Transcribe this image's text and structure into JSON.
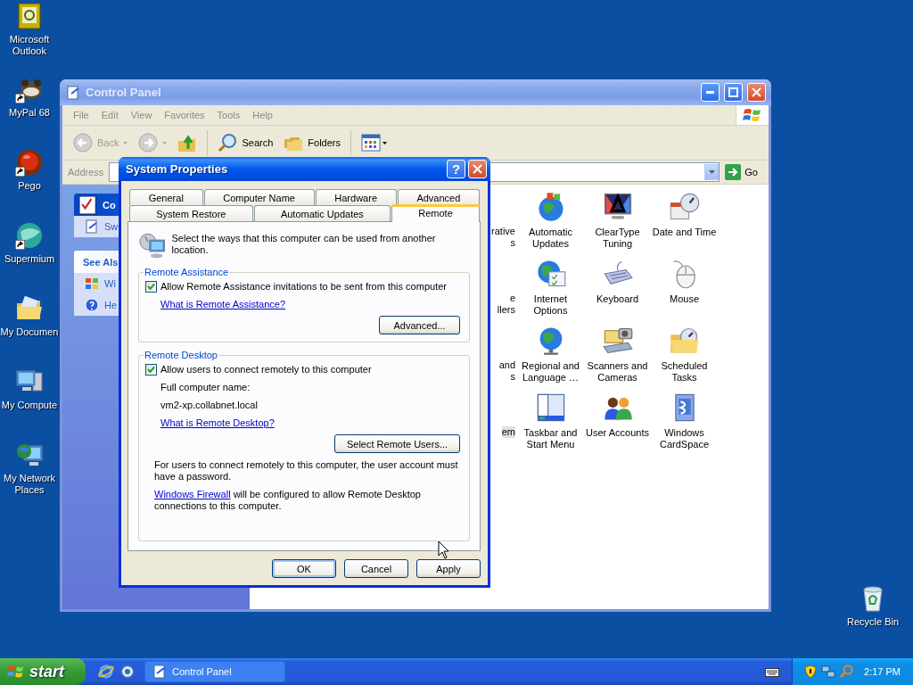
{
  "desktop_icons": [
    {
      "label": "Microsoft Outlook",
      "shortcut": false
    },
    {
      "label": "MyPal 68",
      "shortcut": true
    },
    {
      "label": "Pego",
      "shortcut": true
    },
    {
      "label": "Supermium",
      "shortcut": true
    },
    {
      "label": "My Documen",
      "shortcut": false
    },
    {
      "label": "My Compute",
      "shortcut": false
    },
    {
      "label": "My Network Places",
      "shortcut": false
    }
  ],
  "recycle_bin": {
    "label": "Recycle Bin"
  },
  "control_panel": {
    "title": "Control Panel",
    "active": false,
    "menu": [
      "File",
      "Edit",
      "View",
      "Favorites",
      "Tools",
      "Help"
    ],
    "toolbar": {
      "back": "Back",
      "search": "Search",
      "folders": "Folders"
    },
    "address": {
      "label": "Address",
      "go": "Go"
    },
    "task_box": {
      "title": "Co",
      "items": [
        "Sw"
      ]
    },
    "see_also": {
      "title": "See Als",
      "items": [
        "Wi",
        "He"
      ]
    },
    "partial_items": [
      {
        "lines": [
          "rative",
          "s"
        ],
        "selected": false
      },
      {
        "lines": [
          "e",
          "llers"
        ],
        "selected": false
      },
      {
        "lines": [
          "and",
          "s"
        ],
        "selected": false
      },
      {
        "lines": [
          "em"
        ],
        "selected": true
      }
    ],
    "items": [
      {
        "label": "Automatic Updates"
      },
      {
        "label": "ClearType Tuning"
      },
      {
        "label": "Date and Time"
      },
      {
        "label": "Internet Options"
      },
      {
        "label": "Keyboard"
      },
      {
        "label": "Mouse"
      },
      {
        "label": "Regional and Language …"
      },
      {
        "label": "Scanners and Cameras"
      },
      {
        "label": "Scheduled Tasks"
      },
      {
        "label": "Taskbar and Start Menu"
      },
      {
        "label": "User Accounts"
      },
      {
        "label": "Windows CardSpace"
      }
    ]
  },
  "dialog": {
    "title": "System Properties",
    "help": "?",
    "tabs_row1": [
      {
        "label": "General",
        "selected": false
      },
      {
        "label": "Computer Name",
        "selected": false
      },
      {
        "label": "Hardware",
        "selected": false
      },
      {
        "label": "Advanced",
        "selected": false
      }
    ],
    "tabs_row2": [
      {
        "label": "System Restore",
        "selected": false
      },
      {
        "label": "Automatic Updates",
        "selected": false
      },
      {
        "label": "Remote",
        "selected": true
      }
    ],
    "intro": "Select the ways that this computer can be used from another location.",
    "remote_assistance": {
      "title": "Remote Assistance",
      "checkbox": {
        "label": "Allow Remote Assistance invitations to be sent from this computer",
        "checked": true
      },
      "link": "What is Remote Assistance?",
      "button": "Advanced..."
    },
    "remote_desktop": {
      "title": "Remote Desktop",
      "checkbox": {
        "label": "Allow users to connect remotely to this computer",
        "checked": true
      },
      "name_label": "Full computer name:",
      "name_value": "vm2-xp.collabnet.local",
      "link": "What is Remote Desktop?",
      "button": "Select Remote Users...",
      "note": "For users to connect remotely to this computer, the user account must have a password.",
      "firewall_link": "Windows Firewall",
      "firewall_text": " will be configured to allow Remote Desktop connections to this computer."
    },
    "buttons": [
      {
        "label": "OK",
        "default": true
      },
      {
        "label": "Cancel",
        "default": false
      },
      {
        "label": "Apply",
        "default": false
      }
    ]
  },
  "taskbar": {
    "start": "start",
    "tasks": [
      {
        "label": "Control Panel",
        "selected": false
      }
    ],
    "clock": "2:17 PM"
  }
}
